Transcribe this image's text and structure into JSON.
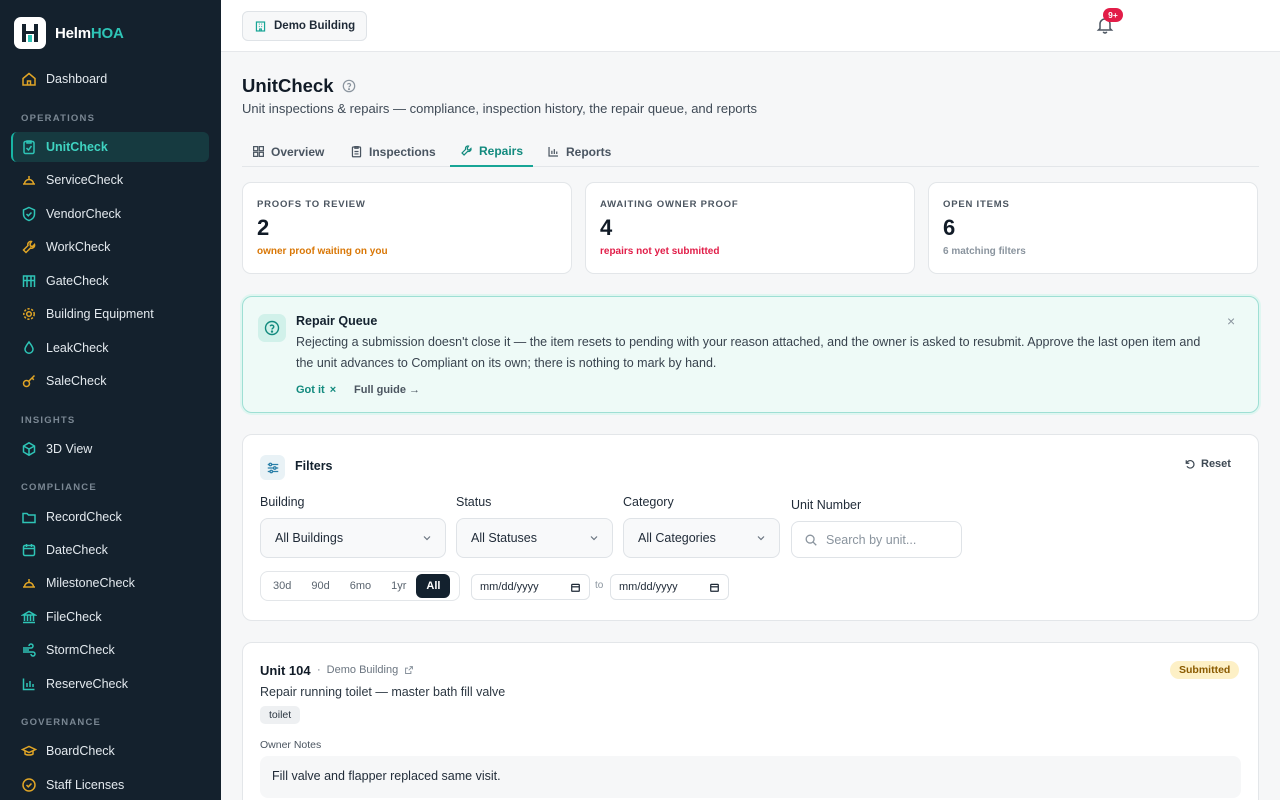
{
  "brand": {
    "name_main": "Helm",
    "name_accent": "HOA"
  },
  "sidebar": {
    "dashboard": "Dashboard",
    "sections": {
      "operations": "OPERATIONS",
      "insights": "INSIGHTS",
      "compliance": "COMPLIANCE",
      "governance": "GOVERNANCE"
    },
    "operations_items": [
      "UnitCheck",
      "ServiceCheck",
      "VendorCheck",
      "WorkCheck",
      "GateCheck",
      "Building Equipment",
      "LeakCheck",
      "SaleCheck"
    ],
    "insights_items": [
      "3D View"
    ],
    "compliance_items": [
      "RecordCheck",
      "DateCheck",
      "MilestoneCheck",
      "FileCheck",
      "StormCheck",
      "ReserveCheck"
    ],
    "governance_items": [
      "BoardCheck",
      "Staff Licenses"
    ],
    "active_item": "UnitCheck"
  },
  "topbar": {
    "building": "Demo Building",
    "notifications_badge": "9+"
  },
  "page": {
    "title": "UnitCheck",
    "subtitle": "Unit inspections & repairs — compliance, inspection history, the repair queue, and reports"
  },
  "tabs": [
    {
      "label": "Overview",
      "icon": "grid-icon"
    },
    {
      "label": "Inspections",
      "icon": "clipboard-icon"
    },
    {
      "label": "Repairs",
      "icon": "wrench-icon"
    },
    {
      "label": "Reports",
      "icon": "bar-chart-icon"
    }
  ],
  "stats": [
    {
      "label": "PROOFS TO REVIEW",
      "value": "2",
      "note": "owner proof waiting on you",
      "note_color": "#d97706"
    },
    {
      "label": "AWAITING OWNER PROOF",
      "value": "4",
      "note": "repairs not yet submitted",
      "note_color": "#e11d48"
    },
    {
      "label": "OPEN ITEMS",
      "value": "6",
      "note": "6 matching filters",
      "note_color": "#8a949e"
    }
  ],
  "callout": {
    "title": "Repair Queue",
    "body": "Rejecting a submission doesn't close it — the item resets to pending with your reason attached, and the owner is asked to resubmit. Approve the last open item and the unit advances to Compliant on its own; there is nothing to mark by hand.",
    "got_it": "Got it",
    "guide": "Full guide →",
    "close": "×"
  },
  "filters": {
    "title": "Filters",
    "reset": "Reset",
    "building_label": "Building",
    "building_value": "All Buildings",
    "status_label": "Status",
    "status_value": "All Statuses",
    "category_label": "Category",
    "category_value": "All Categories",
    "unit_label": "Unit Number",
    "unit_placeholder": "Search by unit...",
    "ranges": [
      "30d",
      "90d",
      "6mo",
      "1yr",
      "All"
    ],
    "active_range": "All",
    "date_from": "mm/dd/yyyy",
    "date_to": "mm/dd/yyyy",
    "to": "to"
  },
  "repair": {
    "unit": "Unit 104",
    "separator": "·",
    "building": "Demo Building",
    "status": "Submitted",
    "description": "Repair running toilet — master bath fill valve",
    "tag": "toilet",
    "notes_label": "Owner Notes",
    "notes": "Fill valve and flapper replaced same visit."
  },
  "colors": {
    "sidebar_bg": "#14212d",
    "accent": "#18a596",
    "icon_gold": "#e0a526",
    "icon_teal": "#2ec4b6"
  }
}
